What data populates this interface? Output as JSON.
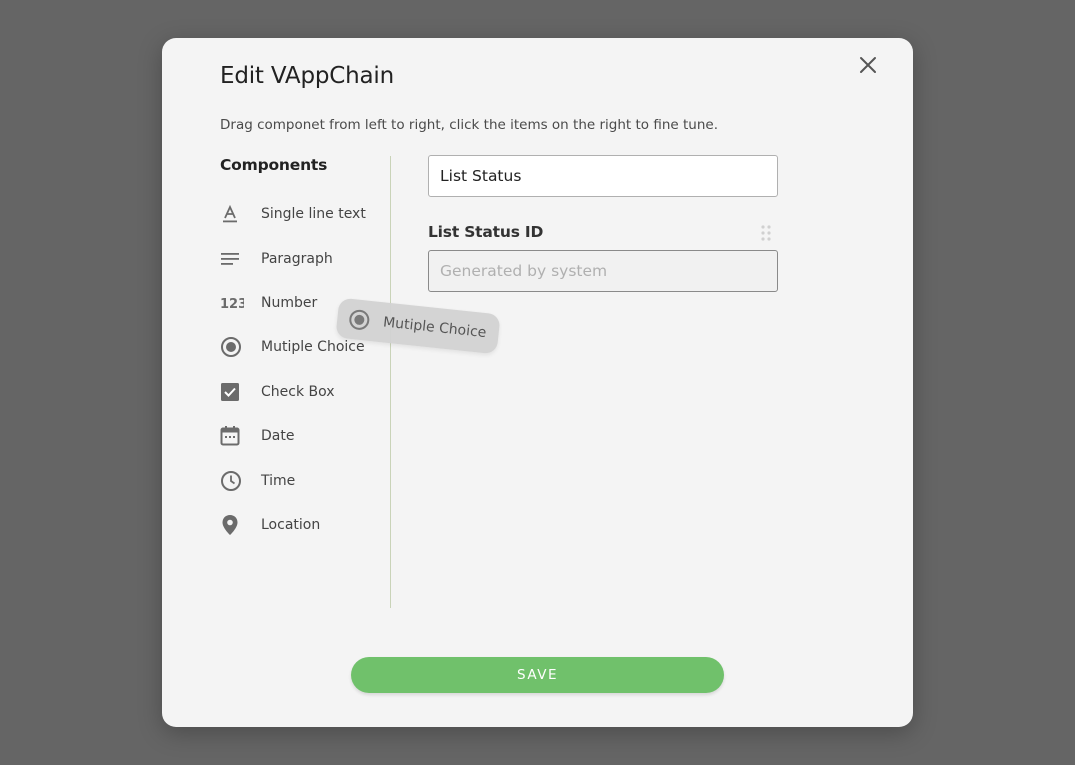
{
  "dialog": {
    "title": "Edit VAppChain",
    "subtitle": "Drag componet from left to right, click the items on the right to fine tune."
  },
  "components": {
    "heading": "Components",
    "items": [
      {
        "label": "Single line text",
        "icon": "text-format-icon"
      },
      {
        "label": "Paragraph",
        "icon": "paragraph-icon"
      },
      {
        "label": "Number",
        "icon": "number-icon"
      },
      {
        "label": "Mutiple Choice",
        "icon": "radio-button-icon"
      },
      {
        "label": "Check Box",
        "icon": "checkbox-icon"
      },
      {
        "label": "Date",
        "icon": "calendar-icon"
      },
      {
        "label": "Time",
        "icon": "clock-icon"
      },
      {
        "label": "Location",
        "icon": "location-pin-icon"
      }
    ]
  },
  "canvas": {
    "name_value": "List Status",
    "field_label": "List Status ID",
    "field_placeholder": "Generated by system"
  },
  "drag_ghost": {
    "label": "Mutiple Choice",
    "icon": "radio-button-icon"
  },
  "save_label": "SAVE",
  "colors": {
    "backdrop": "#656565",
    "dialog_bg": "#f4f4f4",
    "save_button": "#70c16b",
    "icon": "#6b6b6b"
  }
}
